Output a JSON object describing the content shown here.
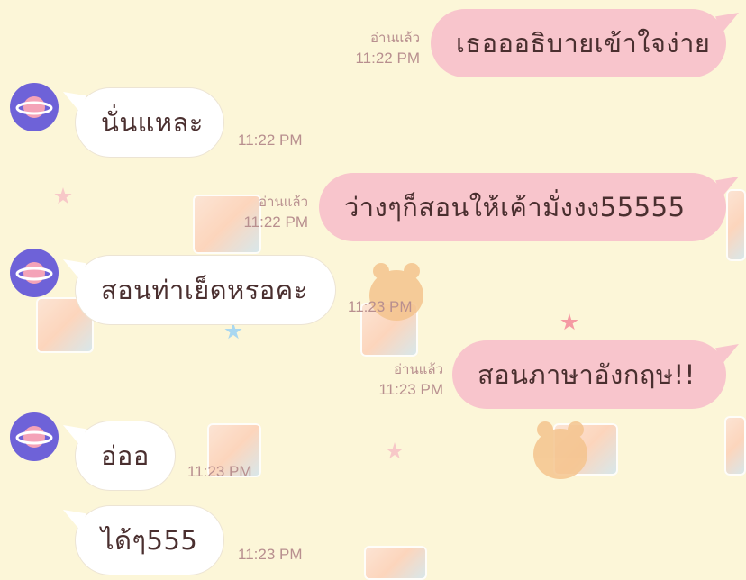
{
  "colors": {
    "background": "#fcf6d8",
    "incoming_bubble": "#ffffff",
    "outgoing_bubble": "#f8c5cc",
    "avatar": "#6e62d8",
    "meta_text": "#b88f8f"
  },
  "messages": [
    {
      "direction": "out",
      "text": "เธอออธิบายเข้าใจง่าย",
      "read": "อ่านแล้ว",
      "time": "11:22 PM"
    },
    {
      "direction": "in",
      "text": "นั่นแหละ",
      "time": "11:22 PM"
    },
    {
      "direction": "out",
      "text": "ว่างๆก็สอนให้เค้ามั่งงง55555",
      "read": "อ่านแล้ว",
      "time": "11:22 PM"
    },
    {
      "direction": "in",
      "text": "สอนท่าเย็ดหรอคะ",
      "time": "11:23 PM"
    },
    {
      "direction": "out",
      "text": "สอนภาษาอังกฤษ!!",
      "read": "อ่านแล้ว",
      "time": "11:23 PM"
    },
    {
      "direction": "in",
      "text": "อ่ออ",
      "time": "11:23 PM"
    },
    {
      "direction": "in",
      "text": "ได้ๆ555",
      "time": "11:23 PM"
    }
  ]
}
